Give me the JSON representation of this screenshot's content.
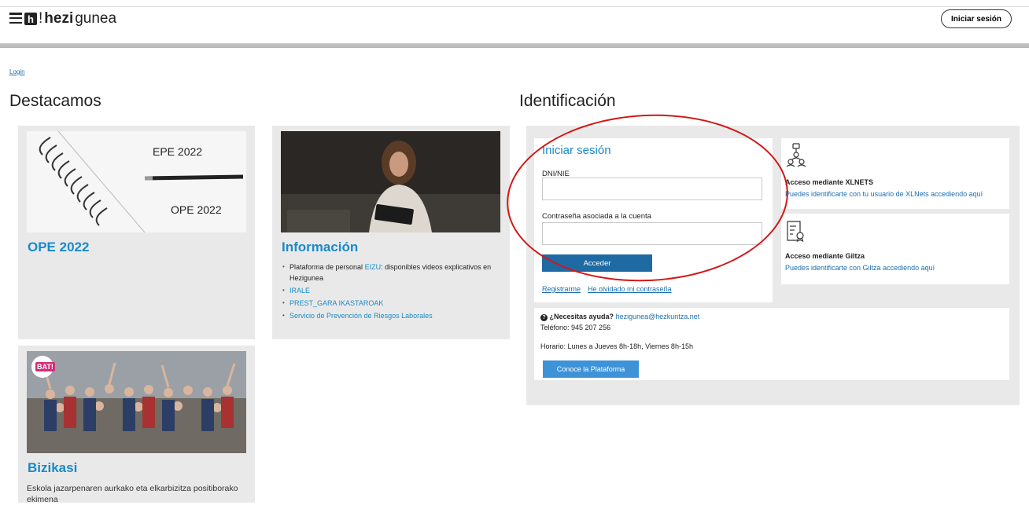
{
  "header": {
    "logo_letter": "h",
    "logo_bang": "!",
    "logo_bold": "hezi",
    "logo_rest": "gunea",
    "login_button": "Iniciar sesión"
  },
  "breadcrumb": "Login",
  "featured": {
    "heading": "Destacamos",
    "cards": [
      {
        "title": "OPE 2022",
        "image_labels": [
          "EPE 2022",
          "OPE 2022"
        ]
      },
      {
        "title": "Información",
        "items": [
          {
            "prefix": "Plataforma de personal ",
            "link": "EIZU",
            "suffix": ": disponibles videos explicativos en Hezigunea"
          },
          {
            "link": "IRALE"
          },
          {
            "link": "PREST_GARA IKASTAROAK"
          },
          {
            "link": "Servicio de Prevención de Riesgos Laborales"
          }
        ]
      },
      {
        "title": "Bizikasi",
        "badge": "BAT!",
        "description": "Eskola jazarpenaren aurkako eta elkarbizitza positiborako ekimena"
      }
    ]
  },
  "identification": {
    "heading": "Identificación",
    "login_title": "Iniciar sesión",
    "dni_label": "DNI/NIE",
    "password_label": "Contraseña asociada a la cuenta",
    "submit": "Acceder",
    "register_link": "Registrarme",
    "forgot_link": "He olvidado mi contraseña",
    "xlnets": {
      "icon": "network-users-icon",
      "title": "Acceso mediante XLNETS",
      "link": "Puedes identificarte con tu usuario de XLNets accediendo aquí"
    },
    "giltza": {
      "icon": "certificate-icon",
      "title": "Acceso mediante Giltza",
      "link": "Puedes identificarte con Giltza accediendo aquí"
    },
    "help": {
      "question": "¿Necesitas ayuda?",
      "email": "hezigunea@hezkuntza.net",
      "phone": "Teléfono: 945 207 256",
      "hours": "Horario: Lunes a Jueves 8h-18h, Viernes 8h-15h",
      "platform_button": "Conoce la Plataforma"
    }
  },
  "colors": {
    "accent": "#1a8ac7",
    "button": "#1f6aa3",
    "annotation": "#d41616"
  }
}
